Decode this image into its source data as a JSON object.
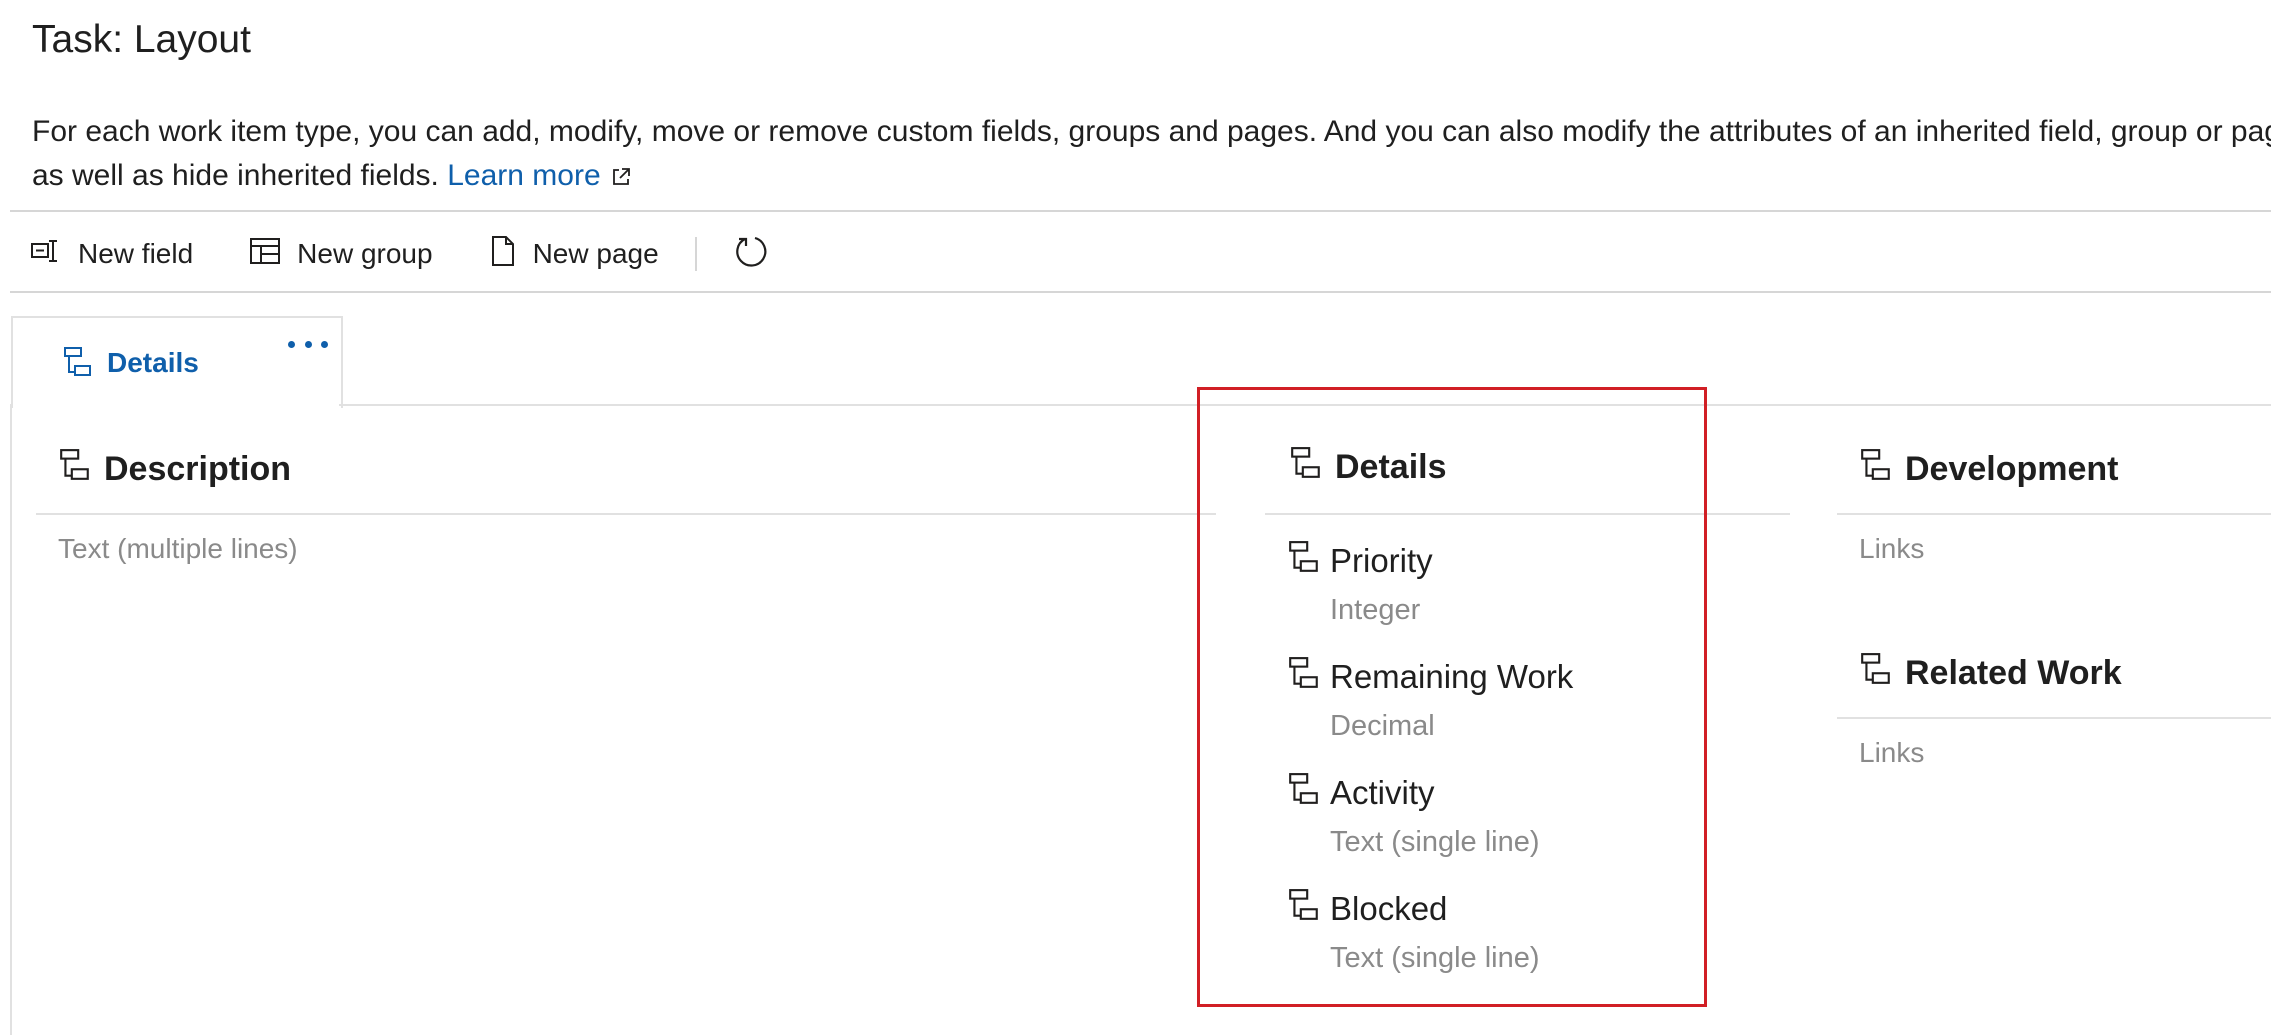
{
  "header": {
    "title": "Task: Layout",
    "description_line1": "For each work item type, you can add, modify, move or remove custom fields, groups and pages. And you can also modify the attributes of an inherited field, group or page,",
    "description_line2": "as well as hide inherited fields.",
    "learn_more": "Learn more"
  },
  "toolbar": {
    "new_field": "New field",
    "new_group": "New group",
    "new_page": "New page",
    "refresh_icon": "refresh-icon"
  },
  "page_tab": {
    "label": "Details",
    "more_icon": "ellipsis-icon"
  },
  "columns": {
    "description": {
      "title": "Description",
      "type": "Text (multiple lines)"
    },
    "details": {
      "title": "Details",
      "fields": [
        {
          "name": "Priority",
          "type": "Integer"
        },
        {
          "name": "Remaining Work",
          "type": "Decimal"
        },
        {
          "name": "Activity",
          "type": "Text (single line)"
        },
        {
          "name": "Blocked",
          "type": "Text (single line)"
        }
      ]
    },
    "development": {
      "title": "Development",
      "type": "Links"
    },
    "related_work": {
      "title": "Related Work",
      "type": "Links"
    }
  },
  "colors": {
    "accent": "#0f5fab",
    "highlight": "#d11f25"
  }
}
